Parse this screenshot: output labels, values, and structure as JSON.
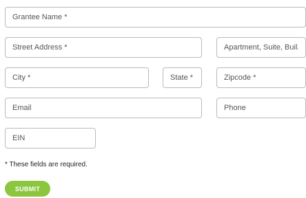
{
  "form": {
    "grantee_name": {
      "placeholder": "Grantee Name *",
      "value": ""
    },
    "street_address": {
      "placeholder": "Street Address *",
      "value": ""
    },
    "apartment": {
      "placeholder": "Apartment, Suite, Buil...",
      "value": ""
    },
    "city": {
      "placeholder": "City *",
      "value": ""
    },
    "state": {
      "placeholder": "State *",
      "value": ""
    },
    "zipcode": {
      "placeholder": "Zipcode *",
      "value": ""
    },
    "email": {
      "placeholder": "Email",
      "value": ""
    },
    "phone": {
      "placeholder": "Phone",
      "value": ""
    },
    "ein": {
      "placeholder": "EIN",
      "value": ""
    },
    "required_note": "* These fields are required.",
    "submit_label": "SUBMIT"
  },
  "colors": {
    "submit_bg": "#8cc63e",
    "field_border": "#b9b9b9"
  }
}
